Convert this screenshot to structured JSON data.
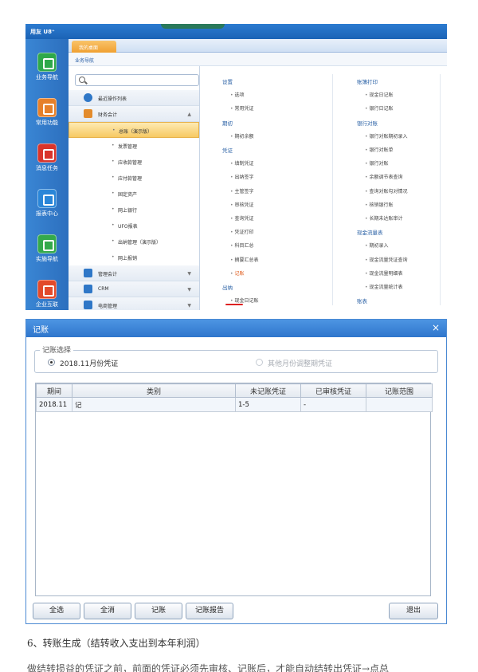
{
  "main_window": {
    "logo": "用友 U8⁺",
    "tab": "我的桌面",
    "breadcrumb": "业务导航",
    "left_nav": [
      {
        "label": "业务导航",
        "icon": "business-nav-icon",
        "color": "#2ea84a"
      },
      {
        "label": "常用功能",
        "icon": "star-icon",
        "color": "#e6802a"
      },
      {
        "label": "消息任务",
        "icon": "chart-icon",
        "color": "#d9342b"
      },
      {
        "label": "报表中心",
        "icon": "report-icon",
        "color": "#2a86d8"
      },
      {
        "label": "实施导航",
        "icon": "compass-icon",
        "color": "#34a94b"
      },
      {
        "label": "企业互联",
        "icon": "network-icon",
        "color": "#e24a2b"
      }
    ],
    "sidebar": {
      "search_placeholder": "",
      "items": [
        {
          "label": "最近操作列表",
          "type": "group",
          "icon": "clock-icon"
        },
        {
          "label": "财务会计",
          "type": "group",
          "icon": "finance-icon",
          "arrow": "▲"
        },
        {
          "label": "总账（演示版）",
          "type": "sub-active"
        },
        {
          "label": "发票管理",
          "type": "sub"
        },
        {
          "label": "应收款管理",
          "type": "sub"
        },
        {
          "label": "应付款管理",
          "type": "sub"
        },
        {
          "label": "固定资产",
          "type": "sub"
        },
        {
          "label": "网上银行",
          "type": "sub"
        },
        {
          "label": "UFO报表",
          "type": "sub"
        },
        {
          "label": "出纳管理（演示版）",
          "type": "sub"
        },
        {
          "label": "网上报销",
          "type": "sub"
        },
        {
          "label": "管理会计",
          "type": "group",
          "icon": "management-icon",
          "arrow": "▼"
        },
        {
          "label": "CRM",
          "type": "group",
          "icon": "crm-icon",
          "arrow": "▼"
        },
        {
          "label": "电商管理",
          "type": "group",
          "icon": "cart-icon",
          "arrow": "▼"
        }
      ]
    },
    "content": {
      "col1": [
        {
          "text": "设置",
          "kind": "head"
        },
        {
          "text": "选项",
          "kind": "item"
        },
        {
          "text": "常用凭证",
          "kind": "item"
        },
        {
          "text": "期初",
          "kind": "head"
        },
        {
          "text": "期初余额",
          "kind": "item"
        },
        {
          "text": "凭证",
          "kind": "head"
        },
        {
          "text": "填制凭证",
          "kind": "item"
        },
        {
          "text": "出纳签字",
          "kind": "item"
        },
        {
          "text": "主管签字",
          "kind": "item"
        },
        {
          "text": "审核凭证",
          "kind": "item"
        },
        {
          "text": "查询凭证",
          "kind": "item"
        },
        {
          "text": "凭证打印",
          "kind": "item"
        },
        {
          "text": "科目汇总",
          "kind": "item"
        },
        {
          "text": "摘要汇总表",
          "kind": "item"
        },
        {
          "text": "记账",
          "kind": "item-sel"
        },
        {
          "text": "出纳",
          "kind": "head"
        },
        {
          "text": "现金日记账",
          "kind": "item"
        }
      ],
      "col2": [
        {
          "text": "账簿打印",
          "kind": "head"
        },
        {
          "text": "现金日记账",
          "kind": "item"
        },
        {
          "text": "银行日记账",
          "kind": "item"
        },
        {
          "text": "银行对账",
          "kind": "head"
        },
        {
          "text": "银行对账期初录入",
          "kind": "item"
        },
        {
          "text": "银行对账单",
          "kind": "item"
        },
        {
          "text": "银行对账",
          "kind": "item"
        },
        {
          "text": "余额调节表查询",
          "kind": "item"
        },
        {
          "text": "查询对账勾对情况",
          "kind": "item"
        },
        {
          "text": "核销银行账",
          "kind": "item"
        },
        {
          "text": "长期未达账审计",
          "kind": "item"
        },
        {
          "text": "现金流量表",
          "kind": "head"
        },
        {
          "text": "期初录入",
          "kind": "item"
        },
        {
          "text": "现金流量凭证查询",
          "kind": "item"
        },
        {
          "text": "现金流量明细表",
          "kind": "item"
        },
        {
          "text": "现金流量统计表",
          "kind": "item"
        },
        {
          "text": "账表",
          "kind": "head"
        }
      ]
    }
  },
  "dialog": {
    "title": "记账",
    "close": "×",
    "selection_label": "记账选择",
    "option1": "2018.11月份凭证",
    "option2": "其他月份调整期凭证",
    "columns": [
      "期间",
      "类别",
      "未记账凭证",
      "已审核凭证",
      "记账范围"
    ],
    "rows": [
      [
        "2018.11",
        "记",
        "1-5",
        "-",
        ""
      ]
    ],
    "buttons": {
      "select_all": "全选",
      "clear_all": "全消",
      "post": "记账",
      "report": "记账报告",
      "exit": "退出"
    }
  },
  "doc": {
    "heading": "6、转账生成（结转收入支出到本年利润）",
    "paragraph": "做结转损益的凭证之前，前面的凭证必须先审核、记账后，才能自动结转出凭证→点总"
  }
}
